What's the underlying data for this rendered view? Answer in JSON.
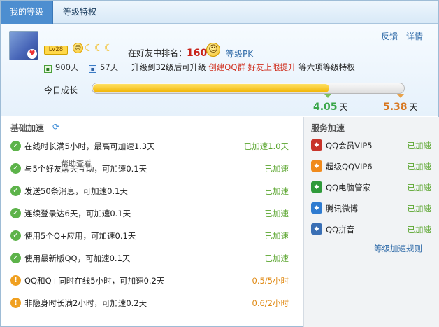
{
  "tabs": [
    {
      "label": "我的等级",
      "active": true
    },
    {
      "label": "等级特权",
      "active": false
    }
  ],
  "header": {
    "level_badge": "LV28",
    "suns": [
      "😊",
      "☾",
      "☾",
      "☾"
    ],
    "rank_label": "在好友中排名：",
    "rank_value": "160",
    "pk_link": "等级PK",
    "links": [
      "反馈",
      "详情"
    ],
    "days_total": "900天",
    "days_remaining": "57天",
    "upgrade_prefix": "升级到32级后可升级",
    "upgrade_red": "创建QQ群 好友上限提升",
    "upgrade_suffix": "等六项等级特权",
    "today_label": "今日成长",
    "progress_fraction": 0.757,
    "value_green": "4.05",
    "value_orange": "5.38",
    "unit": "天"
  },
  "basic": {
    "title": "基础加速",
    "items": [
      {
        "text": "在线时长满5小时，最高可加速1.3天",
        "status": "已加速1.0天",
        "done": true
      },
      {
        "text": "与5个好友聊天互动，可加速0.1天",
        "status": "已加速",
        "done": true
      },
      {
        "text": "发送50条消息，可加速0.1天",
        "status": "已加速",
        "done": true
      },
      {
        "text": "连续登录达6天，可加速0.1天",
        "status": "已加速",
        "done": true
      },
      {
        "text": "使用5个Q+应用，可加速0.1天",
        "status": "已加速",
        "done": true
      },
      {
        "text": "使用最新版QQ，可加速0.1天",
        "status": "已加速",
        "done": true
      },
      {
        "text": "QQ和Q+同时在线5小时，可加速0.2天",
        "status": "0.5/5小时",
        "done": false
      },
      {
        "text": "非隐身时长满2小时，可加速0.2天",
        "status": "0.6/2小时",
        "done": false
      }
    ],
    "tooltip": "帮助查看"
  },
  "service": {
    "title": "服务加速",
    "items": [
      {
        "label": "QQ会员VIP5",
        "status": "已加速",
        "icon": "qq-member-icon",
        "color": "#c8342a"
      },
      {
        "label": "超级QQVIP6",
        "status": "已加速",
        "icon": "super-qq-icon",
        "color": "#f08a1c"
      },
      {
        "label": "QQ电脑管家",
        "status": "已加速",
        "icon": "pc-manager-icon",
        "color": "#2f9a3a"
      },
      {
        "label": "腾讯微博",
        "status": "已加速",
        "icon": "weibo-icon",
        "color": "#2e7bd0"
      },
      {
        "label": "QQ拼音",
        "status": "已加速",
        "icon": "pinyin-icon",
        "color": "#3a6fb4"
      }
    ],
    "rules_link": "等级加速规则"
  }
}
